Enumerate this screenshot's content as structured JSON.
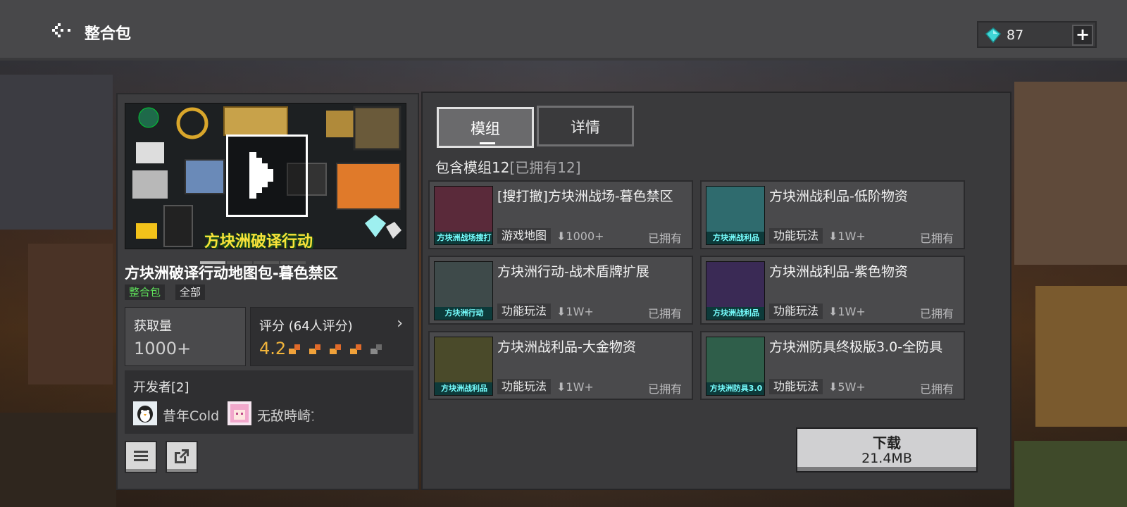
{
  "header": {
    "title": "整合包",
    "back_icon": "back-arrow-icon",
    "currency": {
      "icon": "diamond-icon",
      "amount": "87",
      "add_label": "+"
    }
  },
  "pack": {
    "banner_caption": "方块洲破译行动",
    "title": "方块洲破译行动地图包-暮色禁区",
    "tags": [
      "整合包",
      "全部"
    ],
    "downloads_label": "获取量",
    "downloads_value": "1000+",
    "rating_label": "评分 (64人评分)",
    "rating_value": "4.2",
    "rating_stars": 4.2,
    "developers_label": "开发者[2]",
    "developers": [
      {
        "name": "昔年Cold",
        "avatar": "penguin-avatar"
      },
      {
        "name": "无敌時崎ﾌ",
        "avatar": "pink-hair-avatar"
      }
    ],
    "carousel_pages": 4,
    "carousel_active": 1
  },
  "tabs": [
    "模组",
    "详情"
  ],
  "summary_main": "包含模组12",
  "summary_owned": "[已拥有12]",
  "mods": [
    {
      "title": "[搜打撤]方块洲战场-暮色禁区",
      "tag": "游戏地图",
      "downloads": "1000+",
      "status": "已拥有",
      "thumb_label": "方块洲战场搜打撤",
      "thumb_color": "#5a2a3a"
    },
    {
      "title": "方块洲战利品-低阶物资",
      "tag": "功能玩法",
      "downloads": "1W+",
      "status": "已拥有",
      "thumb_label": "方块洲战利品",
      "thumb_color": "#2f6b6e"
    },
    {
      "title": "方块洲行动-战术盾牌扩展",
      "tag": "功能玩法",
      "downloads": "1W+",
      "status": "已拥有",
      "thumb_label": "方块洲行动",
      "thumb_color": "#3e4a4a"
    },
    {
      "title": "方块洲战利品-紫色物资",
      "tag": "功能玩法",
      "downloads": "1W+",
      "status": "已拥有",
      "thumb_label": "方块洲战利品",
      "thumb_color": "#3a2a55"
    },
    {
      "title": "方块洲战利品-大金物资",
      "tag": "功能玩法",
      "downloads": "1W+",
      "status": "已拥有",
      "thumb_label": "方块洲战利品",
      "thumb_color": "#4a4a2a"
    },
    {
      "title": "方块洲防具终极版3.0-全防具",
      "tag": "功能玩法",
      "downloads": "5W+",
      "status": "已拥有",
      "thumb_label": "方块洲防具3.0",
      "thumb_color": "#2f5e4a"
    }
  ],
  "download": {
    "label": "下载",
    "size": "21.4MB"
  }
}
